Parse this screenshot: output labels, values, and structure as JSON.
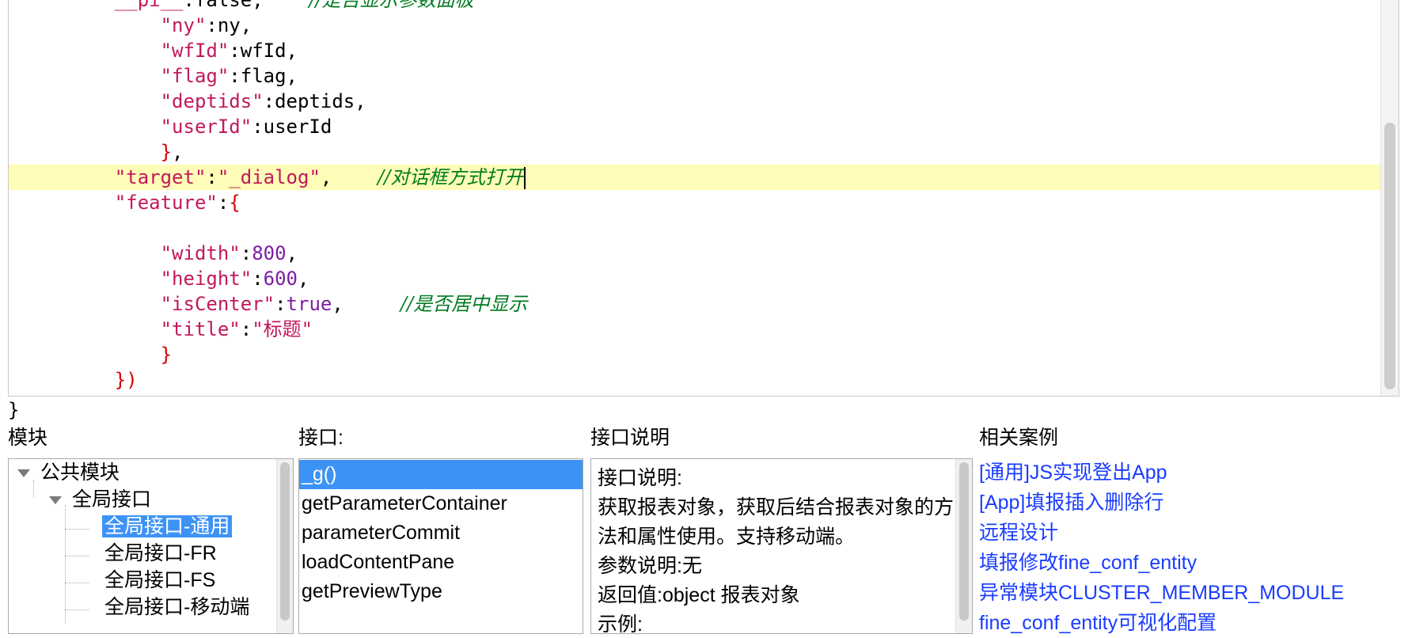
{
  "editor": {
    "lines": [
      {
        "indent": "    ",
        "parts": [
          {
            "text": "__pi__",
            "cls": "t-key"
          },
          {
            "text": ":false,    ",
            "cls": "t-plain"
          },
          {
            "text": "//是否显示参数面板",
            "cls": "t-cmt"
          }
        ]
      },
      {
        "indent": "        ",
        "parts": [
          {
            "text": "\"ny\"",
            "cls": "t-key"
          },
          {
            "text": ":ny,",
            "cls": "t-plain"
          }
        ]
      },
      {
        "indent": "        ",
        "parts": [
          {
            "text": "\"wfId\"",
            "cls": "t-key"
          },
          {
            "text": ":wfId,",
            "cls": "t-plain"
          }
        ]
      },
      {
        "indent": "        ",
        "parts": [
          {
            "text": "\"flag\"",
            "cls": "t-key"
          },
          {
            "text": ":flag,",
            "cls": "t-plain"
          }
        ]
      },
      {
        "indent": "        ",
        "parts": [
          {
            "text": "\"deptids\"",
            "cls": "t-key"
          },
          {
            "text": ":deptids,",
            "cls": "t-plain"
          }
        ]
      },
      {
        "indent": "        ",
        "parts": [
          {
            "text": "\"userId\"",
            "cls": "t-key"
          },
          {
            "text": ":userId",
            "cls": "t-plain"
          }
        ]
      },
      {
        "indent": "        ",
        "parts": [
          {
            "text": "}",
            "cls": "t-bracket"
          },
          {
            "text": ",",
            "cls": "t-plain"
          }
        ]
      },
      {
        "indent": "    ",
        "active": true,
        "caret": true,
        "parts": [
          {
            "text": "\"target\"",
            "cls": "t-key"
          },
          {
            "text": ":",
            "cls": "t-plain"
          },
          {
            "text": "\"_dialog\"",
            "cls": "t-str"
          },
          {
            "text": ",    ",
            "cls": "t-plain"
          },
          {
            "text": "//对话框方式打开",
            "cls": "t-cmt"
          }
        ]
      },
      {
        "indent": "    ",
        "parts": [
          {
            "text": "\"feature\"",
            "cls": "t-key"
          },
          {
            "text": ":",
            "cls": "t-plain"
          },
          {
            "text": "{",
            "cls": "t-bracket"
          }
        ]
      },
      {
        "indent": "",
        "parts": []
      },
      {
        "indent": "        ",
        "parts": [
          {
            "text": "\"width\"",
            "cls": "t-key"
          },
          {
            "text": ":",
            "cls": "t-plain"
          },
          {
            "text": "800",
            "cls": "t-num"
          },
          {
            "text": ",",
            "cls": "t-plain"
          }
        ]
      },
      {
        "indent": "        ",
        "parts": [
          {
            "text": "\"height\"",
            "cls": "t-key"
          },
          {
            "text": ":",
            "cls": "t-plain"
          },
          {
            "text": "600",
            "cls": "t-num"
          },
          {
            "text": ",",
            "cls": "t-plain"
          }
        ]
      },
      {
        "indent": "        ",
        "parts": [
          {
            "text": "\"isCenter\"",
            "cls": "t-key"
          },
          {
            "text": ":",
            "cls": "t-plain"
          },
          {
            "text": "true",
            "cls": "t-kw"
          },
          {
            "text": ",     ",
            "cls": "t-plain"
          },
          {
            "text": "//是否居中显示",
            "cls": "t-cmt"
          }
        ]
      },
      {
        "indent": "        ",
        "parts": [
          {
            "text": "\"title\"",
            "cls": "t-key"
          },
          {
            "text": ":",
            "cls": "t-plain"
          },
          {
            "text": "\"标题\"",
            "cls": "t-str"
          }
        ]
      },
      {
        "indent": "        ",
        "parts": [
          {
            "text": "}",
            "cls": "t-bracket"
          }
        ]
      },
      {
        "indent": "    ",
        "parts": [
          {
            "text": "})",
            "cls": "t-bracket"
          }
        ]
      }
    ],
    "closing_brace": "}"
  },
  "panels": {
    "module_label": "模块",
    "interface_label": "接口:",
    "description_label": "接口说明",
    "examples_label": "相关案例"
  },
  "module_tree": {
    "root": "公共模块",
    "child": "全局接口",
    "leaves": [
      "全局接口-通用",
      "全局接口-FR",
      "全局接口-FS",
      "全局接口-移动端"
    ]
  },
  "interfaces": [
    "_g()",
    "getParameterContainer",
    "parameterCommit",
    "loadContentPane",
    "getPreviewType"
  ],
  "description": [
    "接口说明:",
    "获取报表对象，获取后结合报表对象的方",
    "法和属性使用。支持移动端。",
    "参数说明:无",
    "返回值:object 报表对象",
    "示例:"
  ],
  "examples": [
    "[通用]JS实现登出App",
    "[App]填报插入删除行",
    "远程设计",
    "填报修改fine_conf_entity",
    "异常模块CLUSTER_MEMBER_MODULE",
    "fine_conf_entity可视化配置"
  ],
  "colors": {
    "selection": "#3d93f5",
    "link": "#1a3cff",
    "active_line": "#fefcb7",
    "comment": "#007b1f"
  }
}
